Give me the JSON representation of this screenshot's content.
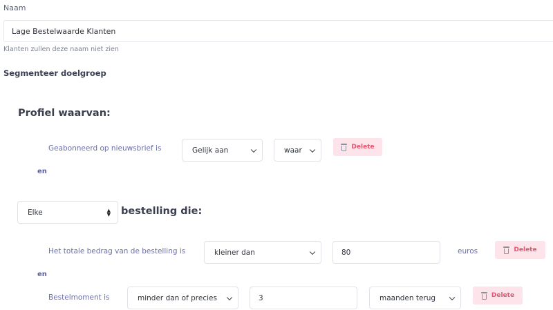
{
  "name_field": {
    "label": "Naam",
    "value": "Lage Bestelwaarde Klanten",
    "helper": "Klanten zullen deze naam niet zien"
  },
  "segment": {
    "title": "Segmenteer doelgroep",
    "profile_title": "Profiel waarvan:",
    "profile_conditions": [
      {
        "label": "Geabonneerd op nieuwsbrief is",
        "operator": "Gelijk aan",
        "value": "waar",
        "delete_label": "Delete"
      }
    ],
    "conjunction_1": "en",
    "order_scope": {
      "selected": "Elke",
      "suffix": "bestelling die:"
    },
    "order_conditions": [
      {
        "label": "Het totale bedrag van de bestelling is",
        "operator": "kleiner dan",
        "value": "80",
        "unit": "euros",
        "delete_label": "Delete"
      },
      {
        "label": "Bestelmoment is",
        "operator": "minder dan of precies",
        "value": "3",
        "unit_select": "maanden terug",
        "delete_label": "Delete"
      }
    ],
    "conjunction_2": "en"
  },
  "colors": {
    "accent_text": "#6a6fa8",
    "delete_bg": "#fde4ea",
    "delete_text": "#e2566f"
  }
}
